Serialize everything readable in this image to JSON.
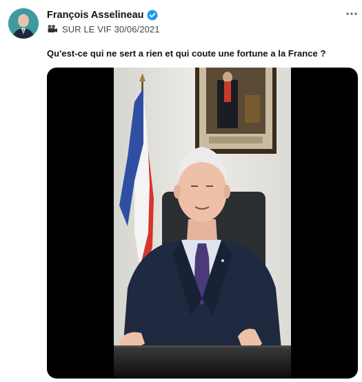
{
  "post": {
    "author_name": "François Asselineau",
    "verified": true,
    "subtitle": "SUR LE VIF 30/06/2021",
    "text": "Qu'est-ce qui ne sert a rien et qui coute une fortune a la France ?",
    "more_icon": "more-horizontal-icon",
    "subtitle_icon": "movie-camera-icon"
  },
  "media": {
    "type": "video",
    "description_icon": "video-thumbnail"
  },
  "colors": {
    "verified_blue": "#1d9bf0",
    "media_background": "#000000",
    "text_primary": "#0f1419"
  }
}
